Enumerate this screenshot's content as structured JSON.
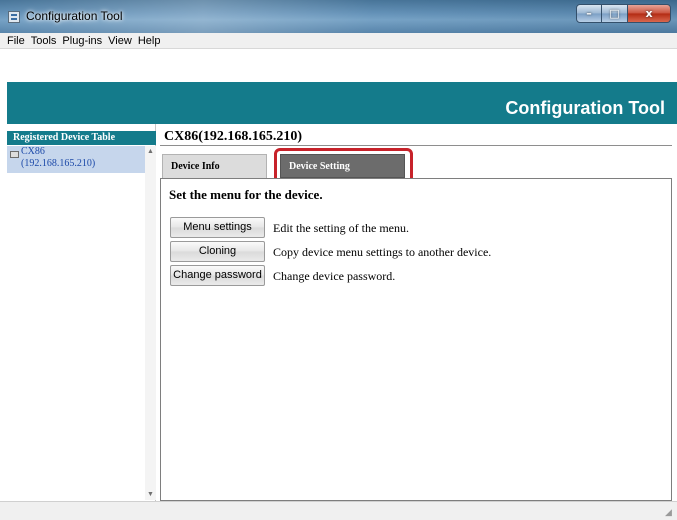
{
  "window": {
    "title": "Configuration Tool",
    "controls": {
      "minimize": "–",
      "maximize": "□",
      "close": "x"
    }
  },
  "menu": [
    "File",
    "Tools",
    "Plug-ins",
    "View",
    "Help"
  ],
  "banner": {
    "title": "Configuration Tool"
  },
  "sidebar": {
    "header": "Registered Device Table",
    "devices": [
      {
        "name": "CX86",
        "ip": "(192.168.165.210)",
        "selected": true
      }
    ]
  },
  "main": {
    "device_title": "CX86(192.168.165.210)",
    "tabs": [
      {
        "label": "Device Info",
        "active": false
      },
      {
        "label": "Device Setting",
        "active": true
      }
    ],
    "heading": "Set the menu for the device.",
    "actions": [
      {
        "button": "Menu settings",
        "description": "Edit the setting of the menu."
      },
      {
        "button": "Cloning",
        "description": "Copy device menu settings to another device."
      },
      {
        "button": "Change password",
        "description": "Change device password."
      }
    ]
  },
  "colors": {
    "banner": "#147b8b",
    "highlight": "#c7222a",
    "selected_row": "#c6d6ec",
    "active_tab": "#6c6c6c"
  }
}
